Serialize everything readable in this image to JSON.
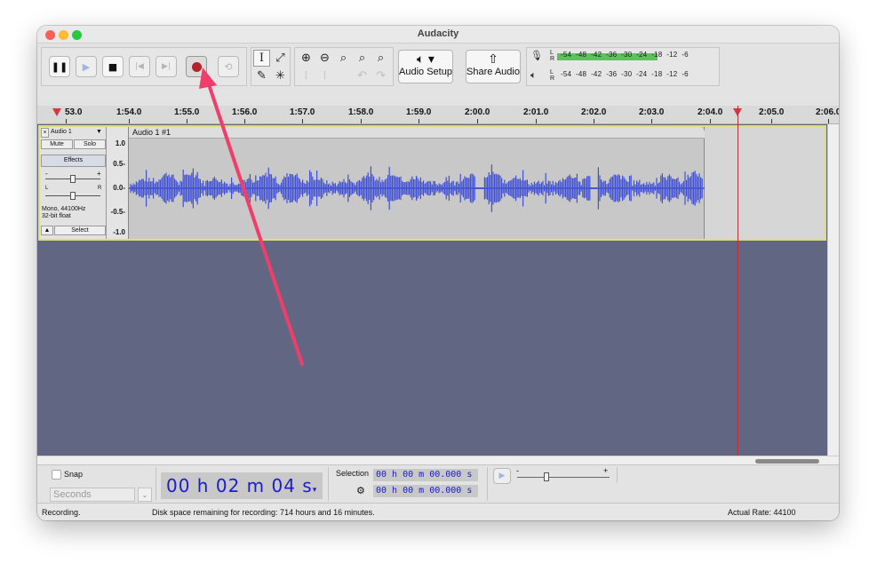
{
  "window": {
    "title": "Audacity"
  },
  "transport": {
    "buttons": [
      {
        "name": "pause-button",
        "glyph": "❚❚"
      },
      {
        "name": "play-button",
        "glyph": "▶"
      },
      {
        "name": "stop-button",
        "glyph": "■"
      },
      {
        "name": "skip-to-start-button",
        "glyph": "|◀"
      },
      {
        "name": "skip-to-end-button",
        "glyph": "▶|"
      },
      {
        "name": "record-button",
        "glyph": "●"
      },
      {
        "name": "loop-button",
        "glyph": "⟲"
      }
    ]
  },
  "tools": {
    "select": "I",
    "envelope": "⤢",
    "draw": "✎",
    "multi": "✳",
    "zoom_in": "⊕",
    "zoom_out": "⊖",
    "fit_selection": "⌕",
    "fit_project": "⌕",
    "zoom_toggle": "⌕",
    "trim": "⁞",
    "silence": "⁞",
    "undo": "↶",
    "redo": "↷"
  },
  "audio_setup": {
    "label": "Audio Setup",
    "icon": "speaker-icon"
  },
  "share_audio": {
    "label": "Share Audio",
    "icon": "share-icon"
  },
  "meters": {
    "record_scale": "L -54 -48 -42 -36 -30 -24 -18 -12 -6 0",
    "playback_scale": "L -54 -48 -42 -36 -30 -24 -18 -12 -6 0",
    "scale_values": [
      "-54",
      "-48",
      "-42",
      "-36",
      "-30",
      "-24",
      "-18",
      "-12",
      "-6"
    ],
    "record_level": 0.62
  },
  "timeline": {
    "labels": [
      "53.0",
      "1:54.0",
      "1:55.0",
      "1:56.0",
      "1:57.0",
      "1:58.0",
      "1:59.0",
      "2:00.0",
      "2:01.0",
      "2:02.0",
      "2:03.0",
      "2:04.0",
      "2:05.0",
      "2:06.0"
    ]
  },
  "track": {
    "name": "Audio 1",
    "mute": "Mute",
    "solo": "Solo",
    "effects": "Effects",
    "gain_minus": "-",
    "gain_plus": "+",
    "pan_left": "L",
    "pan_right": "R",
    "info_line1": "Mono, 44100Hz",
    "info_line2": "32-bit float",
    "select": "Select",
    "collapse": "▲",
    "close": "×",
    "menu_arrow": "▼",
    "clip_title": "Audio 1 #1",
    "scale": [
      "1.0",
      "0.5-",
      "0.0-",
      "-0.5-",
      "-1.0"
    ]
  },
  "bottom": {
    "snap": "Snap",
    "snap_unit": "Seconds",
    "time": "00 h 02 m 04 s",
    "time_arrow": "▾",
    "selection_label": "Selection",
    "sel_start": "00 h 00 m 00.000 s",
    "sel_end": "00 h 00 m 00.000 s",
    "play_speed_minus": "-",
    "play_speed_plus": "+"
  },
  "status": {
    "state": "Recording.",
    "disk": "Disk space remaining for recording: 714 hours and 16 minutes.",
    "rate": "Actual Rate: 44100"
  },
  "colors": {
    "waveform": "#3f4fd6",
    "annotation_arrow": "#f23d6b",
    "playhead": "#c0303a",
    "record": "#b4232b"
  }
}
